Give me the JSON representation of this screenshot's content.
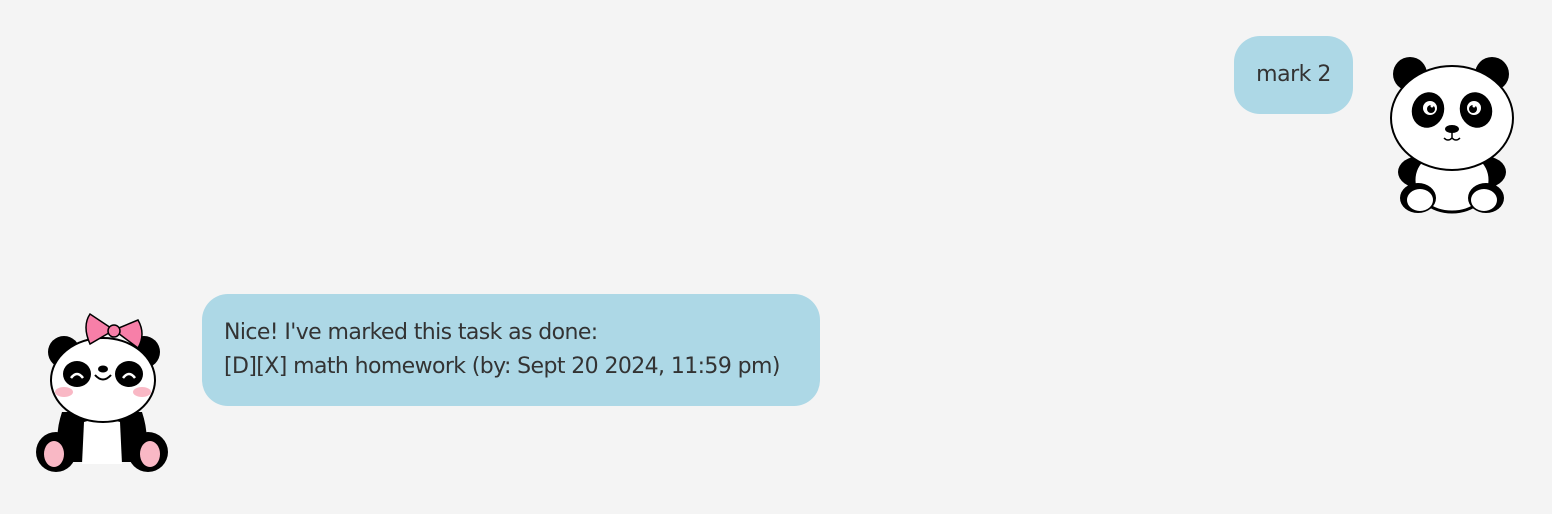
{
  "conversation": {
    "user_message": {
      "text": "mark 2",
      "avatar_icon": "panda-icon"
    },
    "bot_message": {
      "lines": [
        "Nice! I've marked this task as done:",
        "[D][X] math homework (by: Sept 20 2024, 11:59 pm)"
      ],
      "avatar_icon": "panda-with-bow-icon"
    }
  },
  "colors": {
    "background": "#f4f4f4",
    "bubble": "#add8e6",
    "text": "#333333",
    "bow": "#f77fa8",
    "blush": "#f9b8c5"
  }
}
